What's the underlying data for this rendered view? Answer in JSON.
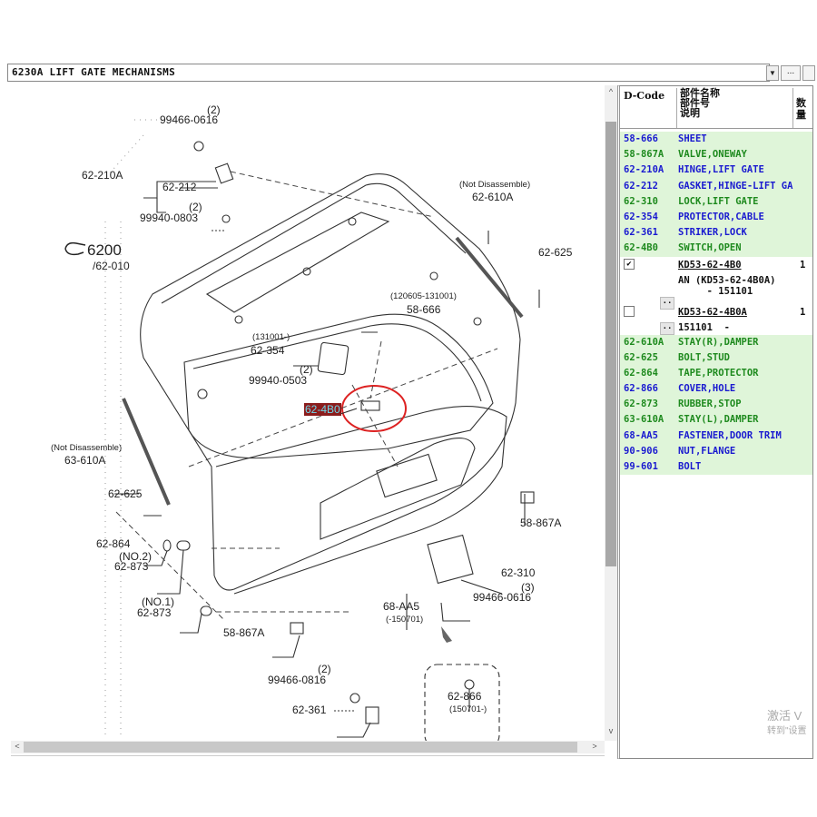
{
  "window": {
    "title": "6230A  LIFT GATE MECHANISMS",
    "dropdown_icon": "chevron-down-icon",
    "more_button_label": "..."
  },
  "diagram": {
    "group_ref": "6200",
    "group_ref_sub": "/62-010",
    "highlighted_callout": "62-4B0",
    "callouts": [
      {
        "id": "99466-0616_top",
        "qty": "(2)",
        "label": "99466-0616"
      },
      {
        "id": "62-210A",
        "label": "62-210A"
      },
      {
        "id": "62-212",
        "label": "62-212"
      },
      {
        "id": "99940-0803",
        "qty": "(2)",
        "label": "99940-0803"
      },
      {
        "id": "62-610A",
        "note": "(Not Disassemble)",
        "label": "62-610A"
      },
      {
        "id": "62-625_right",
        "label": "62-625"
      },
      {
        "id": "58-666",
        "note": "(120605-131001)",
        "label": "58-666"
      },
      {
        "id": "62-354",
        "note": "(131001-)",
        "label": "62-354"
      },
      {
        "id": "99940-0503",
        "qty": "(2)",
        "label": "99940-0503"
      },
      {
        "id": "63-610A",
        "note": "(Not Disassemble)",
        "label": "63-610A"
      },
      {
        "id": "62-625_left",
        "label": "62-625"
      },
      {
        "id": "62-864",
        "label": "62-864"
      },
      {
        "id": "62-873_no2",
        "note": "(NO.2)",
        "label": "62-873"
      },
      {
        "id": "62-873_no1",
        "note": "(NO.1)",
        "label": "62-873"
      },
      {
        "id": "58-867A_left",
        "label": "58-867A"
      },
      {
        "id": "58-867A_right",
        "label": "58-867A"
      },
      {
        "id": "62-310",
        "label": "62-310"
      },
      {
        "id": "99466-0616_bottom",
        "qty": "(3)",
        "label": "99466-0616"
      },
      {
        "id": "68-AA5",
        "label": "68-AA5",
        "note": "(-150701)"
      },
      {
        "id": "99466-0816",
        "qty": "(2)",
        "label": "99466-0816"
      },
      {
        "id": "62-361",
        "label": "62-361"
      },
      {
        "id": "62-866",
        "label": "62-866",
        "note": "(150701-)"
      }
    ]
  },
  "parts_table": {
    "headers": {
      "code": "D-Code",
      "name_line1": "部件名称",
      "name_line2": "部件号",
      "name_line3": "说明",
      "qty_line1": "数",
      "qty_line2": "量"
    },
    "rows_top": [
      {
        "code": "58-666",
        "name": "SHEET",
        "color": "blue"
      },
      {
        "code": "58-867A",
        "name": "VALVE,ONEWAY",
        "color": "green"
      },
      {
        "code": "62-210A",
        "name": "HINGE,LIFT GATE",
        "color": "blue"
      },
      {
        "code": "62-212",
        "name": "GASKET,HINGE-LIFT GA",
        "color": "blue"
      },
      {
        "code": "62-310",
        "name": "LOCK,LIFT GATE",
        "color": "green"
      },
      {
        "code": "62-354",
        "name": "PROTECTOR,CABLE",
        "color": "blue"
      },
      {
        "code": "62-361",
        "name": "STRIKER,LOCK",
        "color": "blue"
      },
      {
        "code": "62-4B0",
        "name": "SWITCH,OPEN",
        "color": "green"
      }
    ],
    "sub_items": [
      {
        "checked": true,
        "part_no": "KD53-62-4B0",
        "qty": "1",
        "note": "AN (KD53-62-4B0A)\n     - 151101",
        "more": ".."
      },
      {
        "checked": false,
        "part_no": "KD53-62-4B0A",
        "qty": "1",
        "note": "151101  -",
        "more": ".."
      }
    ],
    "rows_bottom": [
      {
        "code": "62-610A",
        "name": "STAY(R),DAMPER",
        "color": "green"
      },
      {
        "code": "62-625",
        "name": "BOLT,STUD",
        "color": "green"
      },
      {
        "code": "62-864",
        "name": "TAPE,PROTECTOR",
        "color": "green"
      },
      {
        "code": "62-866",
        "name": "COVER,HOLE",
        "color": "blue"
      },
      {
        "code": "62-873",
        "name": "RUBBER,STOP",
        "color": "green"
      },
      {
        "code": "63-610A",
        "name": "STAY(L),DAMPER",
        "color": "green"
      },
      {
        "code": "68-AA5",
        "name": "FASTENER,DOOR TRIM",
        "color": "blue"
      },
      {
        "code": "90-906",
        "name": "NUT,FLANGE",
        "color": "blue"
      },
      {
        "code": "99-601",
        "name": "BOLT",
        "color": "blue"
      }
    ],
    "colors": {
      "blue": "#1a1ad0",
      "green": "#1e8a1e",
      "row_bg": "#dff5d9"
    }
  },
  "watermark": {
    "line1": "激活 V",
    "line2": "转到\"设置"
  }
}
